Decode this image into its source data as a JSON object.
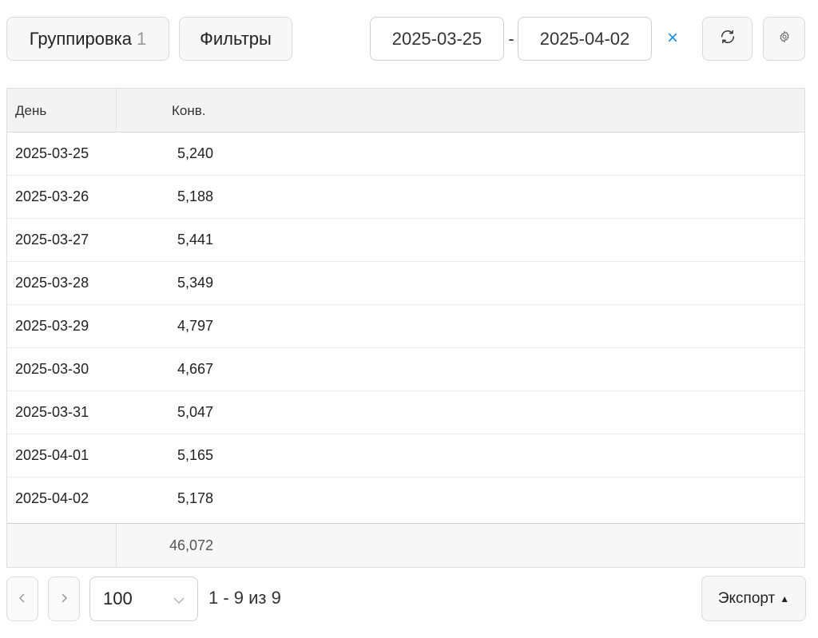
{
  "toolbar": {
    "grouping_label": "Группировка",
    "grouping_count": "1",
    "filters_label": "Фильтры",
    "date_from": "2025-03-25",
    "date_separator": "-",
    "date_to": "2025-04-02",
    "clear_symbol": "×",
    "refresh_icon": "refresh-icon",
    "settings_icon": "gear-icon"
  },
  "table": {
    "columns": [
      "День",
      "Конв."
    ],
    "rows": [
      {
        "day": "2025-03-25",
        "conv": "5,240"
      },
      {
        "day": "2025-03-26",
        "conv": "5,188"
      },
      {
        "day": "2025-03-27",
        "conv": "5,441"
      },
      {
        "day": "2025-03-28",
        "conv": "5,349"
      },
      {
        "day": "2025-03-29",
        "conv": "4,797"
      },
      {
        "day": "2025-03-30",
        "conv": "4,667"
      },
      {
        "day": "2025-03-31",
        "conv": "5,047"
      },
      {
        "day": "2025-04-01",
        "conv": "5,165"
      },
      {
        "day": "2025-04-02",
        "conv": "5,178"
      }
    ],
    "total": "46,072"
  },
  "pagination": {
    "per_page": "100",
    "range_text": "1 - 9 из 9"
  },
  "export": {
    "label": "Экспорт"
  },
  "colors": {
    "accent": "#1f8be0"
  }
}
